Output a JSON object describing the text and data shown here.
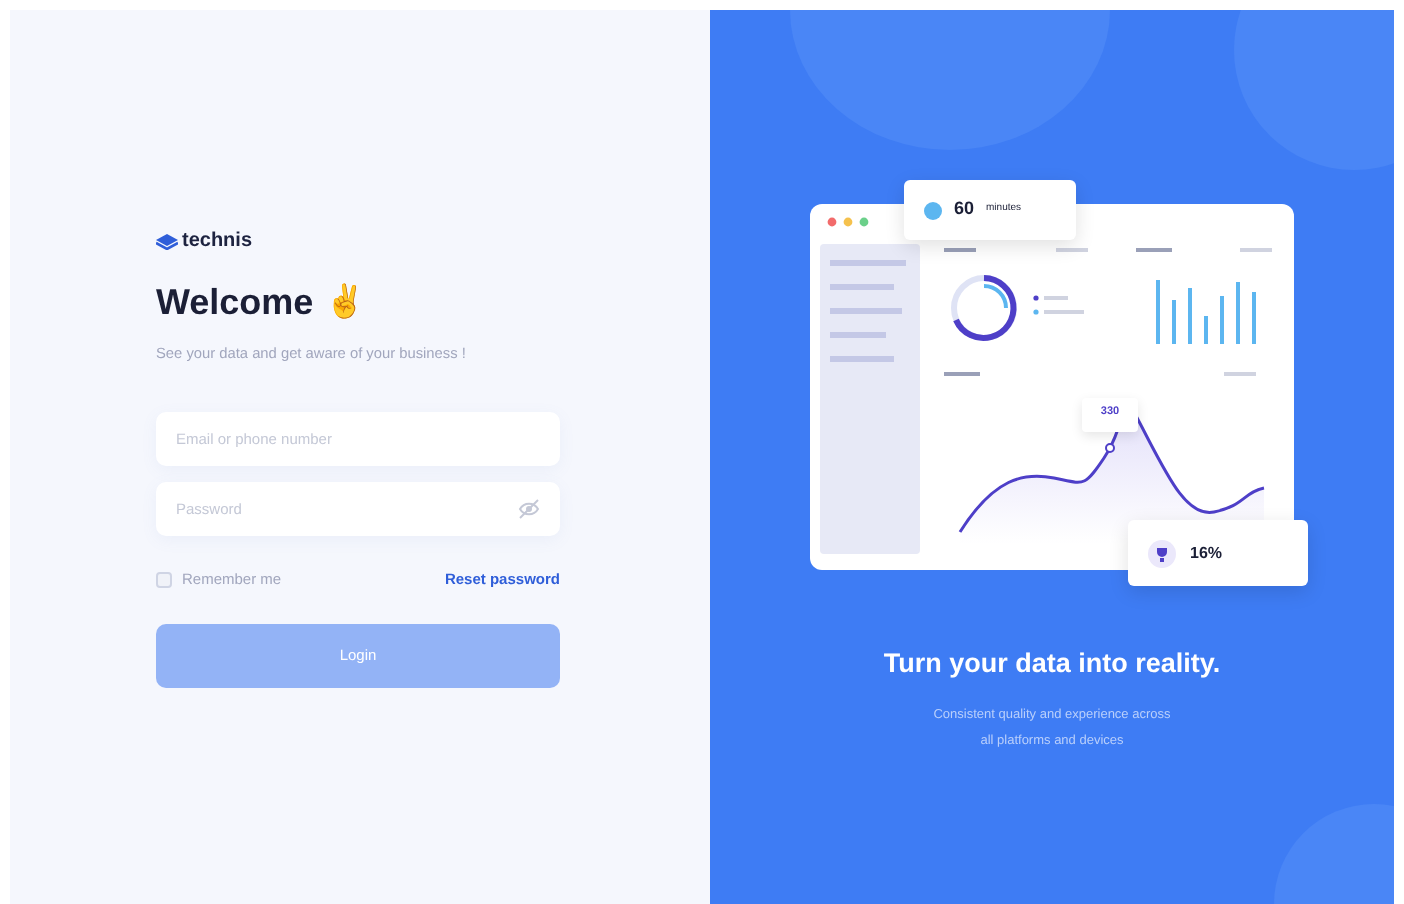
{
  "brand": {
    "name": "technis"
  },
  "heading": "Welcome",
  "heading_emoji": "✌",
  "subtitle": "See your data and get aware of your business !",
  "fields": [
    {
      "kind": "text",
      "placeholder": "Email or phone number"
    },
    {
      "kind": "password",
      "placeholder": "Password"
    }
  ],
  "remember": {
    "label": "Remember me",
    "checked": false
  },
  "reset_link": "Reset password",
  "login_button": {
    "label": "Login",
    "disabled": true
  },
  "illustration": {
    "stat_card": {
      "value": "60",
      "unit": "minutes"
    },
    "tooltip_value": "330",
    "badge": {
      "value": "16%"
    }
  },
  "promo": {
    "title": "Turn your data into reality.",
    "lines": [
      "Consistent quality and experience across",
      "all platforms and devices"
    ]
  }
}
